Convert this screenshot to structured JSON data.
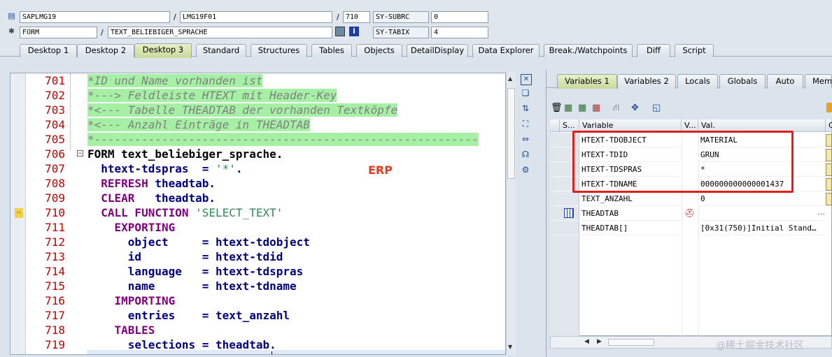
{
  "header": {
    "program": "SAPLMG19",
    "include": "LMG19F01",
    "line": "710",
    "subrc_label": "SY-SUBRC",
    "subrc_value": "0",
    "event_type": "FORM",
    "event_name": "TEXT_BELIEBIGER_SPRACHE",
    "tabix_label": "SY-TABIX",
    "tabix_value": "4",
    "slash": "/"
  },
  "tabs": [
    "Desktop 1",
    "Desktop 2",
    "Desktop 3",
    "Standard",
    "Structures",
    "Tables",
    "Objects",
    "DetailDisplay",
    "Data Explorer",
    "Break./Watchpoints",
    "Diff",
    "Script"
  ],
  "active_tab": "Desktop 3",
  "code": {
    "line_numbers": [
      "701",
      "702",
      "703",
      "704",
      "705",
      "706",
      "707",
      "708",
      "709",
      "710",
      "711",
      "712",
      "713",
      "714",
      "715",
      "716",
      "717",
      "718",
      "719"
    ],
    "l701": "*ID und Name vorhanden ist",
    "l702": "*---> Feldleiste HTEXT mit Header-Key",
    "l703": "*<--- Tabelle THEADTAB der vorhanden Textköpfe",
    "l704": "*<--- Anzahl Einträge in THEADTAB",
    "l705": "*---------------------------------------------------------",
    "l706_kw": "FORM",
    "l706_rest": " text_beliebiger_sprache.",
    "l707_a": "  htext-tdspras  = ",
    "l707_str": "'*'",
    "l707_b": ".",
    "l708_kw": "  REFRESH",
    "l708_rest": " theadtab.",
    "l709_kw": "  CLEAR",
    "l709_rest": "   theadtab.",
    "l710_kw": "  CALL FUNCTION",
    "l710_str": " 'SELECT_TEXT'",
    "l711": "    EXPORTING",
    "l712_a": "      object",
    "l712_b": "     = htext-tdobject",
    "l713_a": "      id",
    "l713_b": "         = htext-tdid",
    "l714_a": "      language",
    "l714_b": "   = htext-tdspras",
    "l715_a": "      name",
    "l715_b": "       = htext-tdname",
    "l716": "    IMPORTING",
    "l717_a": "      entries",
    "l717_b": "    = text_anzahl",
    "l718": "    TABLES",
    "l719_a": "      selections = thead",
    "l719_b": "tab."
  },
  "annotation": "ERP",
  "right_tabs": [
    "Variables 1",
    "Variables 2",
    "Locals",
    "Globals",
    "Auto",
    "Mem"
  ],
  "grid": {
    "col_s": "S...",
    "col_var": "Variable",
    "col_v": "V...",
    "col_val": "Val.",
    "col_c": "C",
    "rows": [
      {
        "var": "HTEXT-TDOBJECT",
        "val": "MATERIAL"
      },
      {
        "var": "HTEXT-TDID",
        "val": "GRUN"
      },
      {
        "var": "HTEXT-TDSPRAS",
        "val": "*"
      },
      {
        "var": "HTEXT-TDNAME",
        "val": "000000000000001437"
      },
      {
        "var": "TEXT_ANZAHL",
        "val": "0"
      },
      {
        "var": "THEADTAB",
        "val": ""
      },
      {
        "var": "THEADTAB[]",
        "val": "[0x31(750)]Initial Stand…"
      }
    ],
    "ellipsis": "…"
  },
  "watermark": "@稀土掘金技术社区",
  "icons": {
    "program": "document-icon",
    "event": "gear-icon",
    "current_line": "arrow-right-icon"
  },
  "colors": {
    "comment_bg": "#a6f0a6",
    "line_number": "#c00000",
    "keyword": "#800080",
    "identifier": "#000080",
    "highlight_box": "#e02020"
  }
}
